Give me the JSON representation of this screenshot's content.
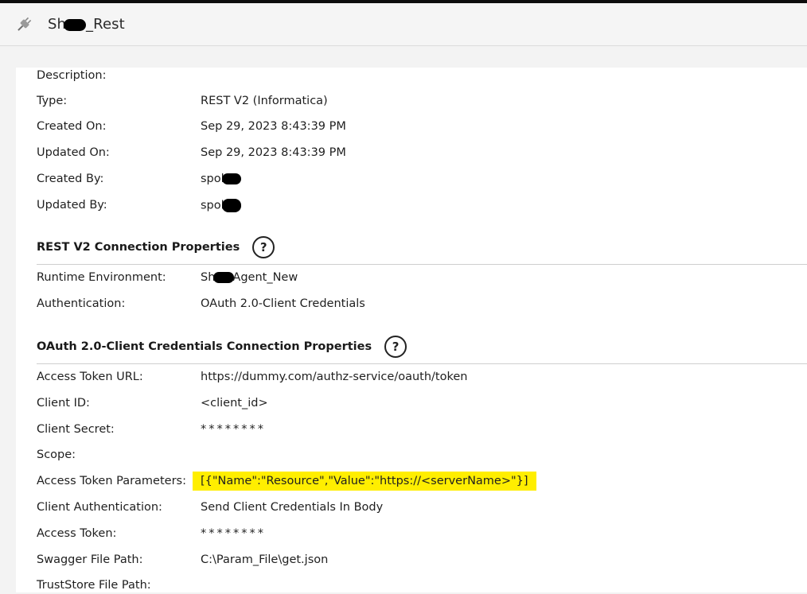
{
  "header": {
    "title_prefix": "Sh",
    "title_suffix": "_Rest",
    "icon": "plug-icon"
  },
  "general": [
    {
      "label": "Description:",
      "value": ""
    },
    {
      "label": "Type:",
      "value": "REST V2 (Informatica)"
    },
    {
      "label": "Created On:",
      "value": "Sep 29, 2023 8:43:39 PM"
    },
    {
      "label": "Updated On:",
      "value": "Sep 29, 2023 8:43:39 PM"
    },
    {
      "label": "Created By:",
      "value": "spol"
    },
    {
      "label": "Updated By:",
      "value": "spol"
    }
  ],
  "section1": {
    "title": "REST V2 Connection Properties",
    "help": "?",
    "runtime": {
      "label": "Runtime Environment:",
      "value_prefix": "Sh",
      "value_suffix": "Agent_New"
    },
    "auth": {
      "label": "Authentication:",
      "value": "OAuth 2.0-Client Credentials"
    }
  },
  "section2": {
    "title": "OAuth 2.0-Client Credentials Connection Properties",
    "help": "?",
    "rows": [
      {
        "label": "Access Token URL:",
        "value": "https://dummy.com/authz-service/oauth/token"
      },
      {
        "label": "Client ID:",
        "value": "<client_id>"
      },
      {
        "label": "Client Secret:",
        "value": "********"
      },
      {
        "label": "Scope:",
        "value": ""
      },
      {
        "label": "Access Token Parameters:",
        "value": "[{\"Name\":\"Resource\",\"Value\":\"https://<serverName>\"}]"
      },
      {
        "label": "Client Authentication:",
        "value": "Send Client Credentials In Body"
      },
      {
        "label": "Access Token:",
        "value": "********"
      },
      {
        "label": "Swagger File Path:",
        "value": "C:\\Param_File\\get.json"
      },
      {
        "label": "TrustStore File Path:",
        "value": ""
      }
    ]
  },
  "colors": {
    "highlight": "#ffee00",
    "topbar": "#0d0d0d"
  }
}
